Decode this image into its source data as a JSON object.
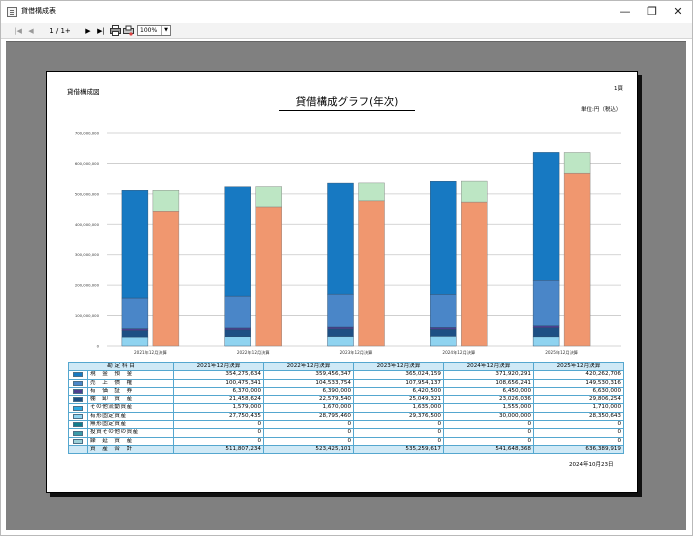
{
  "window": {
    "title": "貸借構成表",
    "minimize": "—",
    "restore": "❐",
    "close": "✕"
  },
  "toolbar": {
    "first": "|◀",
    "prev": "◀",
    "page": "1 / 1+",
    "next": "▶",
    "last": "▶|",
    "print": "print-icon",
    "export": "export-icon",
    "zoom": "100%",
    "zoom_arrow": "▼"
  },
  "report": {
    "header_left": "貸借構成図",
    "title": "貸借構成グラフ(年次)",
    "page": "1頁",
    "unit": "単位:円（税込）",
    "date": "2024年10月23日"
  },
  "chart_data": {
    "type": "bar",
    "stacked": true,
    "grouped": true,
    "categories": [
      "2021年12月決算",
      "2022年12月決算",
      "2023年12月決算",
      "2024年12月決算",
      "2025年12月決算"
    ],
    "ylim": [
      0,
      700000000
    ],
    "yticks": [
      0,
      100000000,
      200000000,
      300000000,
      400000000,
      500000000,
      600000000,
      700000000
    ],
    "ytick_labels": [
      "0",
      "100,000,000",
      "200,000,000",
      "300,000,000",
      "400,000,000",
      "500,000,000",
      "600,000,000",
      "700,000,000"
    ],
    "grid": true,
    "assets_stack": {
      "colors": [
        "#8fd3f0",
        "#1d4f84",
        "#4b3f8f",
        "#4a86c8",
        "#1779c2"
      ],
      "series_index": [
        4,
        3,
        2,
        1,
        0
      ]
    },
    "liabilities_stack": {
      "values": [
        [
          443000000,
          69000000
        ],
        [
          457000000,
          67000000
        ],
        [
          477000000,
          59000000
        ],
        [
          473000000,
          69000000
        ],
        [
          568000000,
          68000000
        ]
      ],
      "colors": [
        "#f0976f",
        "#bde6c4"
      ]
    }
  },
  "table": {
    "headers": [
      "勘 定 科 目",
      "2021年12月決算",
      "2022年12月決算",
      "2023年12月決算",
      "2024年12月決算",
      "2025年12月決算"
    ],
    "rows": [
      {
        "color": "#1779c2",
        "label": "現　金　預　金",
        "values": [
          "354,275,634",
          "359,456,347",
          "365,024,159",
          "371,920,291",
          "420,262,706"
        ]
      },
      {
        "color": "#4a86c8",
        "label": "売　上　債　権",
        "values": [
          "100,475,341",
          "104,533,754",
          "107,954,137",
          "108,656,241",
          "149,530,316"
        ]
      },
      {
        "color": "#4b3f8f",
        "label": "有　価　証　券",
        "values": [
          "6,370,000",
          "6,390,000",
          "6,420,500",
          "6,450,000",
          "6,630,000"
        ]
      },
      {
        "color": "#1d4f84",
        "label": "棚　卸　資　産",
        "values": [
          "21,458,624",
          "22,579,540",
          "25,049,321",
          "23,026,036",
          "29,806,254"
        ]
      },
      {
        "color": "#2aa8e0",
        "label": "その他流動資産",
        "values": [
          "1,579,000",
          "1,670,000",
          "1,635,000",
          "1,555,000",
          "1,710,000"
        ]
      },
      {
        "color": "#8fd3f0",
        "label": "有形固定資産",
        "values": [
          "27,750,435",
          "28,795,460",
          "29,376,500",
          "30,000,000",
          "28,350,643"
        ]
      },
      {
        "color": "#0f7c8c",
        "label": "無形固定資産",
        "values": [
          "0",
          "0",
          "0",
          "0",
          "0"
        ]
      },
      {
        "color": "#3a9aa8",
        "label": "投資その他の資産",
        "values": [
          "0",
          "0",
          "0",
          "0",
          "0"
        ]
      },
      {
        "color": "#9bd0d8",
        "label": "繰　延　資　産",
        "values": [
          "0",
          "0",
          "0",
          "0",
          "0"
        ]
      }
    ],
    "total": {
      "label": "資　産　合　計",
      "values": [
        "511,807,234",
        "523,425,101",
        "535,259,617",
        "541,648,368",
        "636,389,919"
      ]
    }
  }
}
